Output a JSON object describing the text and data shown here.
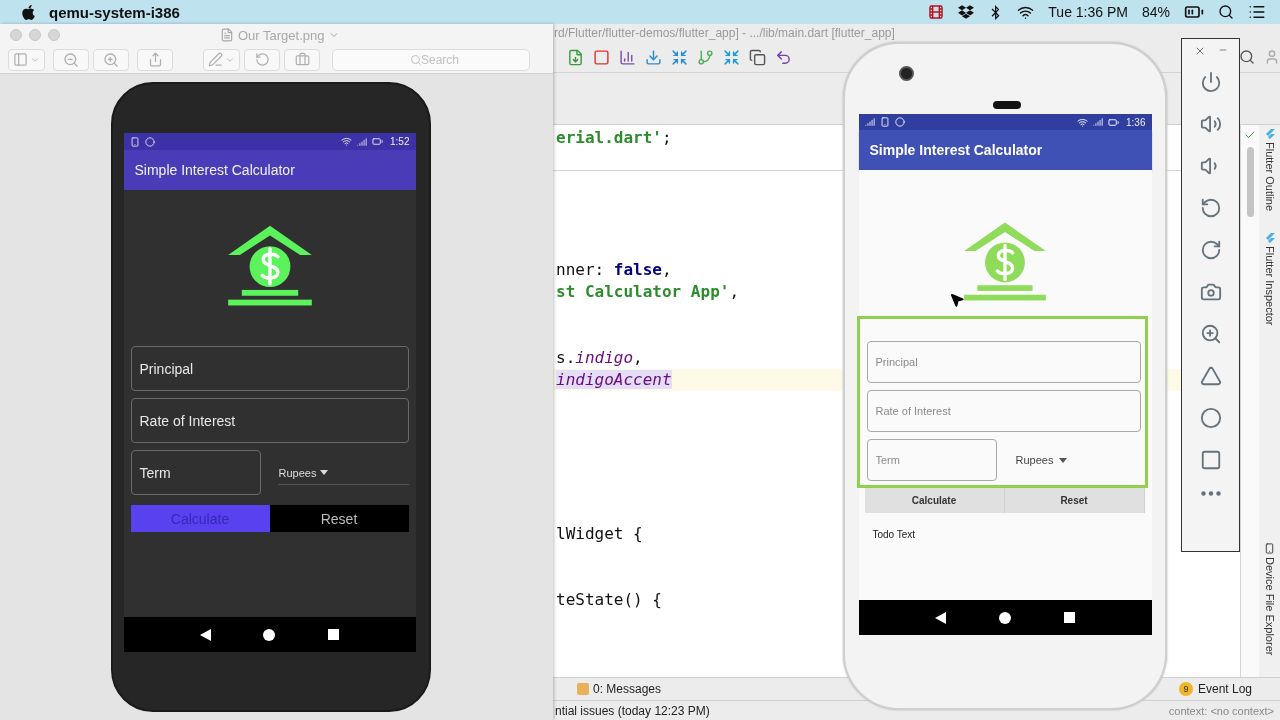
{
  "menu_bar": {
    "app_name": "qemu-system-i386",
    "clock": "Tue 1:36 PM",
    "battery": "84%"
  },
  "preview_window": {
    "title": "Our Target.png",
    "search": {
      "placeholder": "Search"
    },
    "image": {
      "status_time": "1:52",
      "app_title": "Simple Interest Calculator",
      "fields": [
        {
          "placeholder": "Principal"
        },
        {
          "placeholder": "Rate of Interest"
        },
        {
          "placeholder": "Term"
        }
      ],
      "dropdown": {
        "value": "Rupees"
      },
      "buttons": [
        {
          "label": "Calculate",
          "kind": "primary"
        },
        {
          "label": "Reset",
          "kind": "secondary"
        }
      ]
    }
  },
  "ide_window": {
    "title": "rd/Flutter/flutter-demos/flutter_app] - .../lib/main.dart [flutter_app]",
    "code_lines": [
      {
        "current": false,
        "tokens": [
          {
            "text": "erial.dart'",
            "kind": "string"
          },
          {
            "text": ";",
            "kind": "plain"
          }
        ]
      },
      {
        "current": false,
        "tokens": [
          {
            "text": "nner: ",
            "kind": "plain"
          },
          {
            "text": "false",
            "kind": "keyword"
          },
          {
            "text": ",",
            "kind": "plain"
          }
        ]
      },
      {
        "current": false,
        "tokens": [
          {
            "text": "st Calculator App'",
            "kind": "string"
          },
          {
            "text": ",",
            "kind": "plain"
          }
        ]
      },
      {
        "current": false,
        "tokens": [
          {
            "text": "s.",
            "kind": "plain"
          },
          {
            "text": "indigo",
            "kind": "field"
          },
          {
            "text": ",",
            "kind": "plain"
          }
        ]
      },
      {
        "current": true,
        "tokens": [
          {
            "text": "indigoAccent",
            "kind": "selected_field"
          }
        ]
      },
      {
        "current": false,
        "tokens": [
          {
            "text": "lWidget {",
            "kind": "plain"
          }
        ]
      },
      {
        "current": false,
        "tokens": [
          {
            "text": "teState() {",
            "kind": "plain"
          }
        ]
      }
    ],
    "side_tabs": [
      {
        "label": "Flutter Outline"
      },
      {
        "label": "Flutter Inspector"
      },
      {
        "label": "Device File Explorer"
      }
    ],
    "tool_tabs": [
      {
        "label": "0: Messages"
      }
    ],
    "event_log": {
      "badge": "9",
      "label": "Event Log"
    },
    "status_text": "ntial issues (today 12:23 PM)",
    "status_right": "context: <no context>"
  },
  "emulator": {
    "status_time": "1:36",
    "app_title": "Simple Interest Calculator",
    "inspector_highlight": true,
    "fields": [
      {
        "placeholder": "Principal"
      },
      {
        "placeholder": "Rate of Interest"
      },
      {
        "placeholder": "Term"
      }
    ],
    "dropdown": {
      "value": "Rupees"
    },
    "buttons": [
      {
        "label": "Calculate"
      },
      {
        "label": "Reset"
      }
    ],
    "result_text": "Todo Text"
  }
}
